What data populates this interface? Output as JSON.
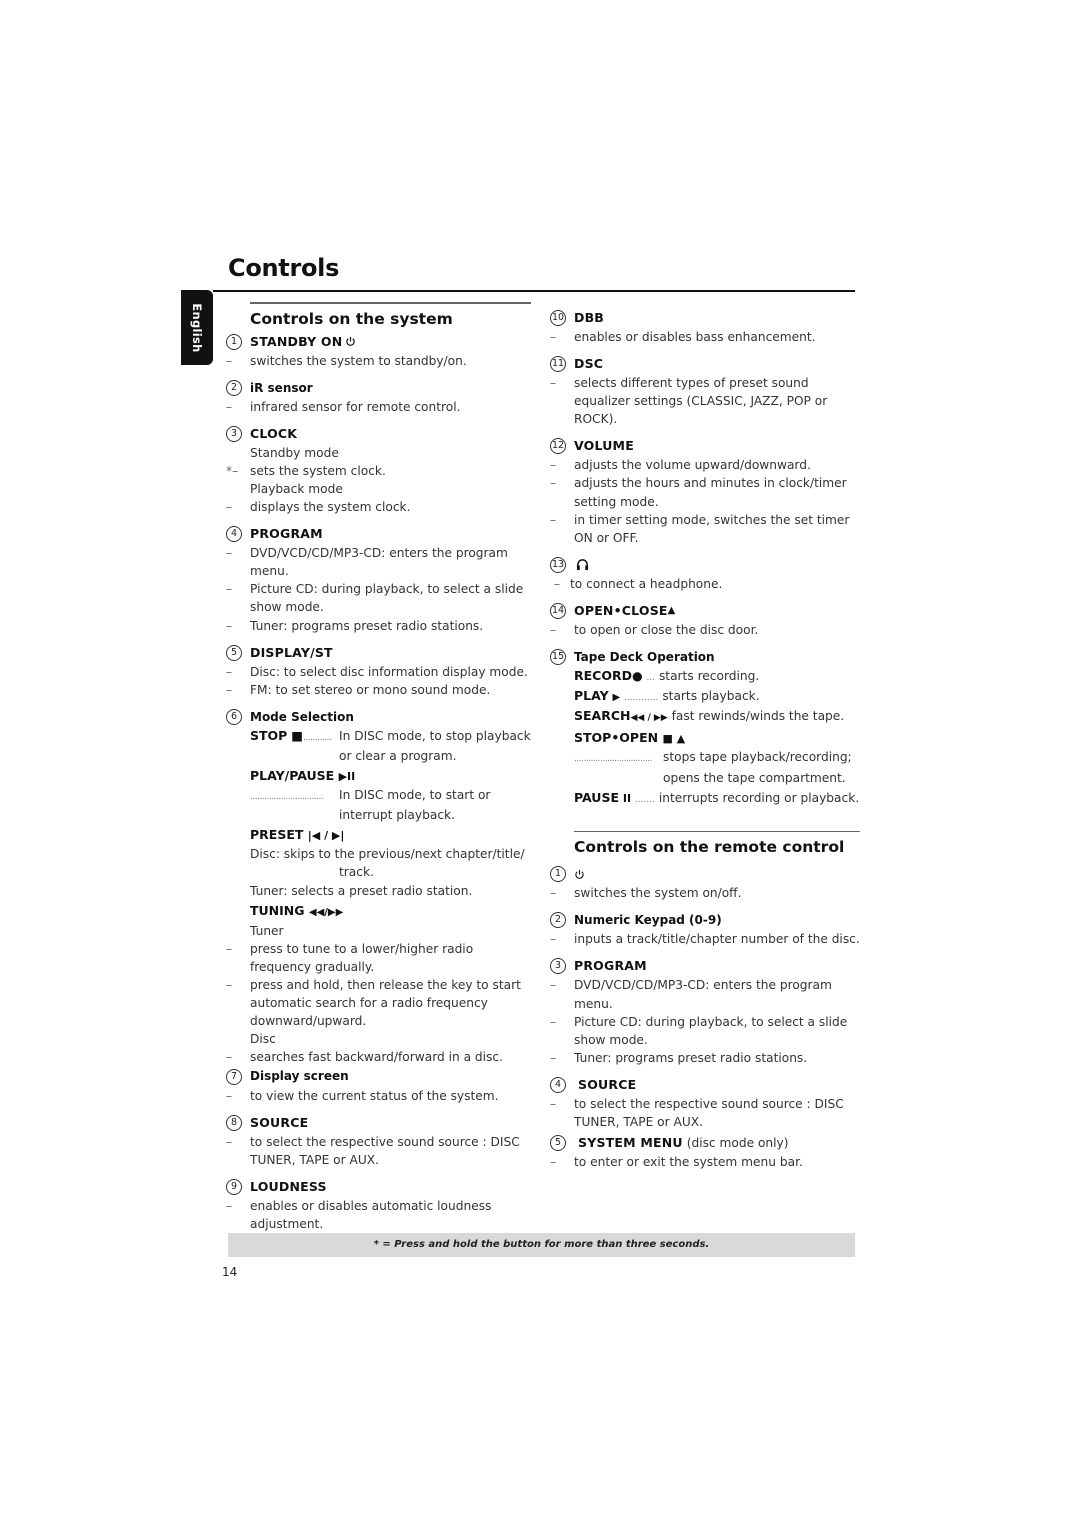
{
  "page": {
    "title": "Controls",
    "language_tab": "English",
    "page_number": "14",
    "footnote": "* = Press and hold the button for more than three seconds."
  },
  "system": {
    "title": "Controls on the system",
    "items": [
      {
        "num": "1",
        "label": "STANDBY ON",
        "icon": "power-icon",
        "lines": [
          "switches the system to standby/on."
        ]
      },
      {
        "num": "2",
        "label": "iR sensor",
        "lines": [
          "infrared sensor for remote control."
        ]
      },
      {
        "num": "3",
        "label": "CLOCK",
        "mode1": "Standby mode",
        "line1_prefix": "*–",
        "line1": "sets the system clock.",
        "mode2": "Playback mode",
        "line2": "displays the system clock."
      },
      {
        "num": "4",
        "label": "PROGRAM",
        "lines": [
          "DVD/VCD/CD/MP3-CD: enters the program menu.",
          "Picture CD: during playback, to select a slide show mode.",
          "Tuner: programs preset radio stations."
        ]
      },
      {
        "num": "5",
        "label": "DISPLAY/ST",
        "lines": [
          "Disc: to select disc information display mode.",
          "FM: to set stereo or mono sound mode."
        ]
      },
      {
        "num": "6",
        "label": "Mode Selection",
        "stop_label": "STOP",
        "stop_glyph": "■",
        "stop_dots": "............",
        "stop_text_1": "In DISC mode, to stop playback",
        "stop_text_2": "or clear a program.",
        "playpause_label": "PLAY/PAUSE",
        "playpause_glyph": "▶II",
        "playpause_dots": "...............................",
        "playpause_text_1": "In DISC mode, to start or",
        "playpause_text_2": "interrupt playback.",
        "preset_label": "PRESET",
        "preset_glyph": "|◀ / ▶|",
        "preset_text_1": "Disc: skips to the previous/next chapter/title/",
        "preset_text_2": "track.",
        "preset_text_3": "Tuner: selects a preset radio station.",
        "tuning_label": "TUNING",
        "tuning_glyph": "◀◀/▶▶",
        "tuning_mode1": "Tuner",
        "tuning_lines": [
          "press to tune to a lower/higher radio frequency gradually.",
          "press and hold, then release the key to start automatic search for a radio frequency downward/upward."
        ],
        "tuning_mode2": "Disc",
        "tuning_line3": "searches fast backward/forward in a disc."
      },
      {
        "num": "7",
        "label": "Display screen",
        "lines": [
          "to view the current status of the system."
        ]
      },
      {
        "num": "8",
        "label": "SOURCE",
        "lines": [
          "to select the respective sound source : DISC TUNER, TAPE or AUX."
        ]
      },
      {
        "num": "9",
        "label": "LOUDNESS",
        "lines": [
          "enables or disables automatic loudness adjustment."
        ]
      },
      {
        "num": "10",
        "label": "DBB",
        "lines": [
          "enables or disables bass enhancement."
        ]
      },
      {
        "num": "11",
        "label": "DSC",
        "lines": [
          "selects different types of preset sound equalizer settings (CLASSIC, JAZZ, POP or ROCK)."
        ]
      },
      {
        "num": "12",
        "label": "VOLUME",
        "lines": [
          "adjusts the volume upward/downward.",
          "adjusts the hours and minutes in clock/timer setting mode.",
          "in timer setting mode, switches the set timer ON or OFF."
        ]
      },
      {
        "num": "13",
        "label": "",
        "icon": "headphone-icon",
        "lines": [
          "to connect a headphone."
        ]
      },
      {
        "num": "14",
        "label": "OPEN•CLOSE",
        "glyph": "▲",
        "lines": [
          "to open or close the disc door."
        ]
      },
      {
        "num": "15",
        "label": "Tape Deck Operation",
        "record_label": "RECORD",
        "record_glyph": "●",
        "record_dots": "...",
        "record_text": "starts recording.",
        "play_label": "PLAY",
        "play_glyph": "▶",
        "play_dots": "............",
        "play_text": "starts playback.",
        "search_label": "SEARCH",
        "search_glyph": "◀◀ / ▶▶",
        "search_text": "fast rewinds/winds the tape.",
        "stopopen_label": "STOP•OPEN",
        "stopopen_glyph": "■ ▲",
        "stopopen_dots": ".................................",
        "stopopen_text_1": "stops tape playback/recording;",
        "stopopen_text_2": "opens the tape compartment.",
        "pause_label": "PAUSE",
        "pause_glyph": "II",
        "pause_dots": ".......",
        "pause_text": "interrupts recording or playback."
      }
    ]
  },
  "remote": {
    "title": "Controls on the remote control",
    "items": [
      {
        "num": "1",
        "label": "",
        "icon": "power-icon",
        "lines": [
          "switches the system on/off."
        ]
      },
      {
        "num": "2",
        "label": "Numeric Keypad (0-9)",
        "lines": [
          "inputs a track/title/chapter number of the disc."
        ]
      },
      {
        "num": "3",
        "label": "PROGRAM",
        "lines": [
          "DVD/VCD/CD/MP3-CD: enters the program menu.",
          "Picture CD: during playback, to select a slide show mode.",
          "Tuner: programs preset radio stations."
        ]
      },
      {
        "num": "4",
        "label": "SOURCE",
        "lines": [
          "to select the respective sound source : DISC TUNER, TAPE or AUX."
        ]
      },
      {
        "num": "5",
        "label": "SYSTEM MENU",
        "suffix": "(disc mode only)",
        "lines": [
          "to enter or exit the system menu bar."
        ]
      }
    ]
  },
  "colors": {
    "text": "#333333",
    "heading": "#111111",
    "footnote_bg": "#d9d9d9",
    "tab_bg": "#111111"
  }
}
